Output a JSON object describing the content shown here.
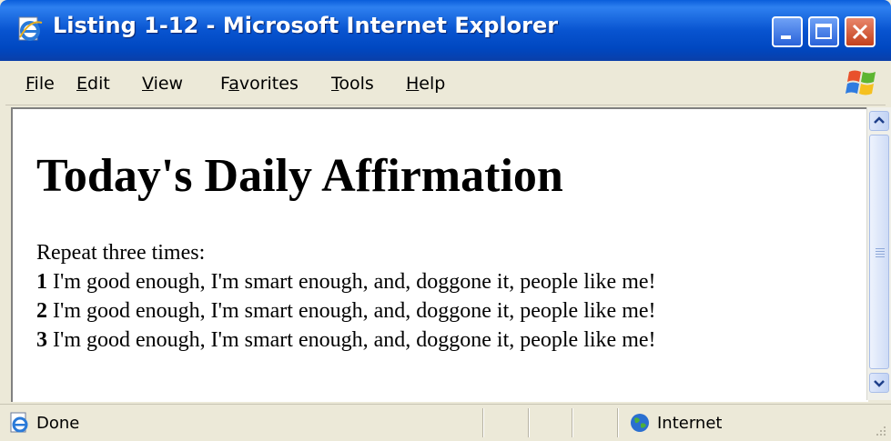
{
  "window": {
    "title": "Listing 1-12 - Microsoft Internet Explorer"
  },
  "menu": {
    "items": [
      {
        "label_acc": "F",
        "label_rest": "ile"
      },
      {
        "label_acc": "E",
        "label_rest": "dit"
      },
      {
        "label_acc": "V",
        "label_rest": "iew"
      },
      {
        "label_pre": "F",
        "label_acc": "a",
        "label_rest": "vorites"
      },
      {
        "label_acc": "T",
        "label_rest": "ools"
      },
      {
        "label_acc": "H",
        "label_rest": "elp"
      }
    ]
  },
  "content": {
    "heading": "Today's Daily Affirmation",
    "intro": "Repeat three times:",
    "lines": [
      {
        "num": "1",
        "text": " I'm good enough, I'm smart enough, and, doggone it, people like me!"
      },
      {
        "num": "2",
        "text": " I'm good enough, I'm smart enough, and, doggone it, people like me!"
      },
      {
        "num": "3",
        "text": " I'm good enough, I'm smart enough, and, doggone it, people like me!"
      }
    ]
  },
  "status": {
    "text": "Done",
    "zone": "Internet"
  },
  "icons": {
    "title": "ie-page-icon",
    "status": "ie-page-icon",
    "zone": "globe-icon",
    "logo": "windows-logo-icon"
  },
  "colors": {
    "titlebar": "#0854d0",
    "close_button": "#c3401c",
    "chrome": "#ece9d8"
  }
}
